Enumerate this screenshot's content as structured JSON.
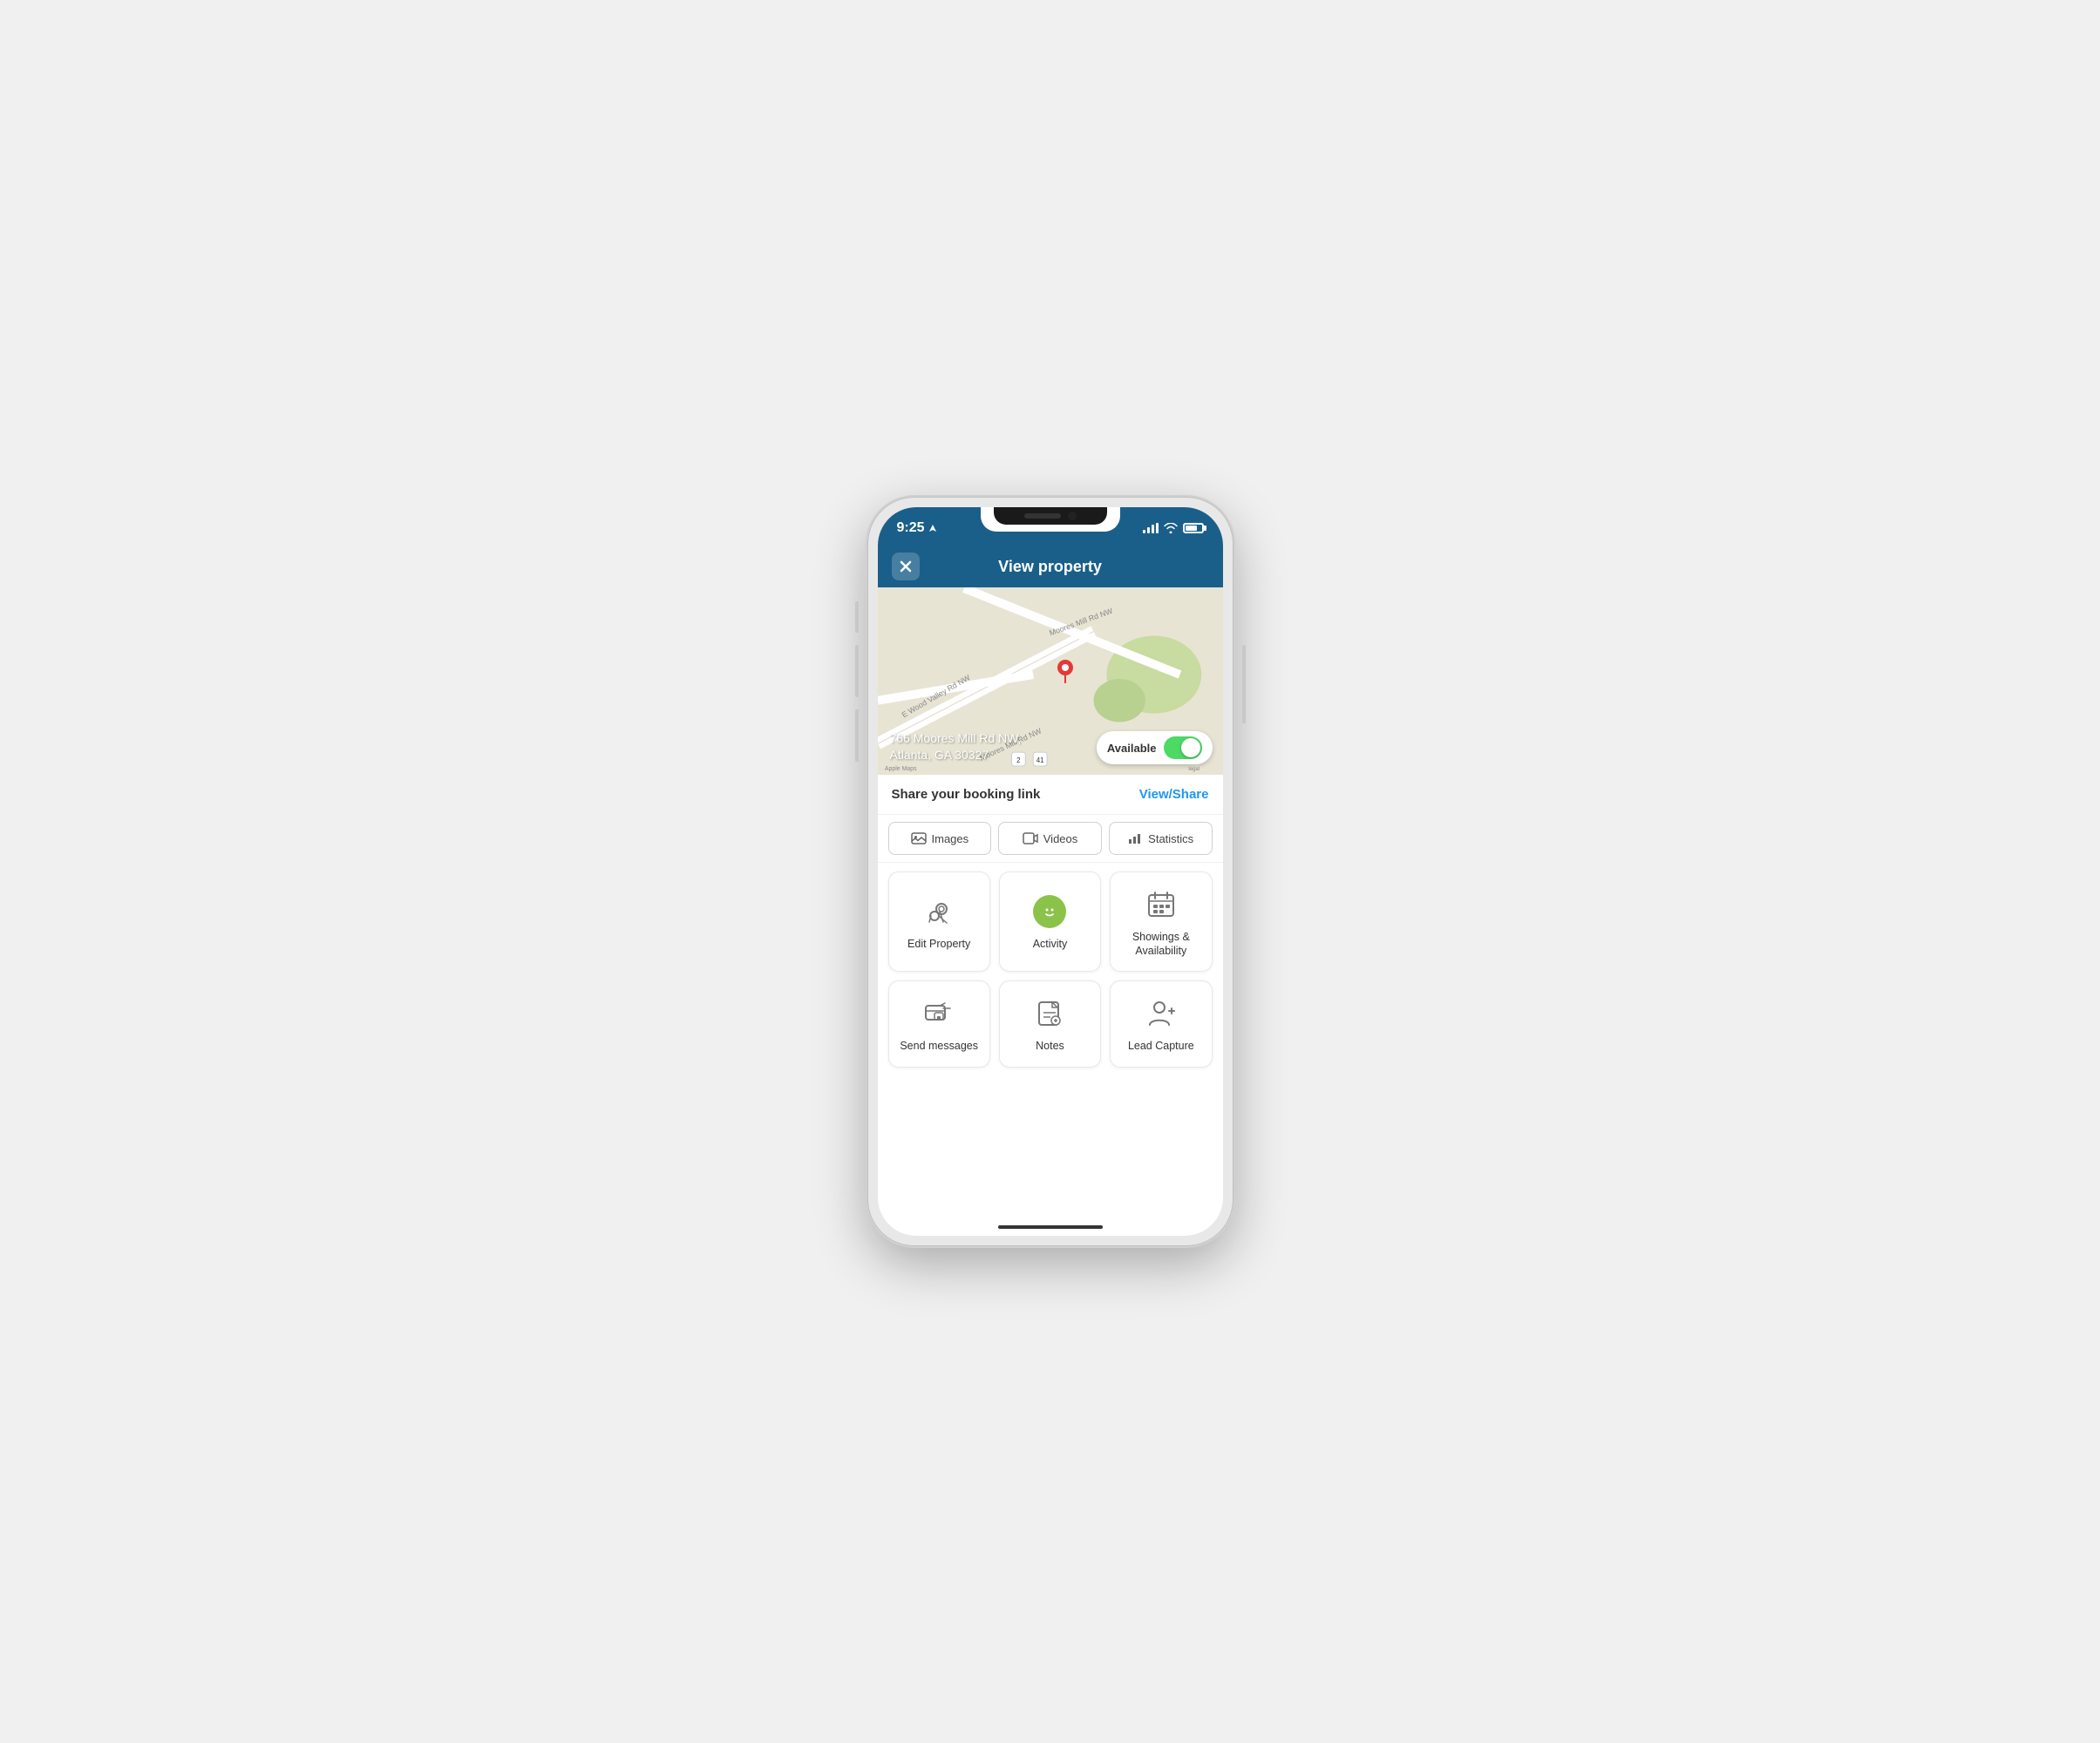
{
  "status_bar": {
    "time": "9:25",
    "location_arrow": "➤"
  },
  "header": {
    "title": "View property",
    "close_label": "×"
  },
  "map": {
    "address_line1": "766 Moores Mill Rd NW,",
    "address_line2": "Atlanta, GA 30327",
    "toggle_label": "Available",
    "toggle_on": true
  },
  "booking_bar": {
    "text": "Share your booking link",
    "link_label": "View/Share"
  },
  "tabs": [
    {
      "id": "images",
      "label": "Images"
    },
    {
      "id": "videos",
      "label": "Videos"
    },
    {
      "id": "statistics",
      "label": "Statistics"
    }
  ],
  "action_tiles_row1": [
    {
      "id": "edit-property",
      "label": "Edit Property"
    },
    {
      "id": "activity",
      "label": "Activity"
    },
    {
      "id": "showings",
      "label": "Showings &\nAvailability"
    }
  ],
  "action_tiles_row2": [
    {
      "id": "send-messages",
      "label": "Send messages"
    },
    {
      "id": "notes",
      "label": "Notes"
    },
    {
      "id": "lead-capture",
      "label": "Lead Capture"
    }
  ]
}
